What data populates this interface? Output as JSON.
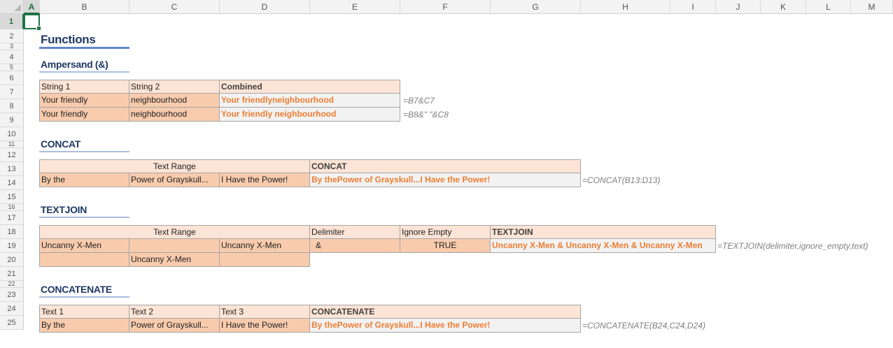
{
  "columns": [
    "A",
    "B",
    "C",
    "D",
    "E",
    "F",
    "G",
    "H",
    "I",
    "J",
    "K",
    "L",
    "M"
  ],
  "rows": [
    "1",
    "2",
    "3",
    "4",
    "5",
    "6",
    "7",
    "8",
    "9",
    "10",
    "11",
    "12",
    "13",
    "14",
    "15",
    "16",
    "17",
    "18",
    "19",
    "20",
    "21",
    "22",
    "23",
    "24",
    "25"
  ],
  "active_cell": "A1",
  "title": "Functions",
  "sections": {
    "ampersand": {
      "heading": "Ampersand (&)",
      "headers": [
        "String 1",
        "String 2",
        "Combined"
      ],
      "rows": [
        {
          "s1": "Your friendly",
          "s2": "neighbourhood",
          "combined": "Your friendlyneighbourhood",
          "formula": "=B7&C7"
        },
        {
          "s1": "Your friendly",
          "s2": "neighbourhood",
          "combined": "Your friendly neighbourhood",
          "formula": "=B8&\" \"&C8"
        }
      ]
    },
    "concat": {
      "heading": "CONCAT",
      "range_header": "Text Range",
      "result_header": "CONCAT",
      "values": [
        "By the",
        "Power of Grayskull...",
        "I Have the Power!"
      ],
      "result": "By thePower of Grayskull...I Have the Power!",
      "formula": "=CONCAT(B13:D13)"
    },
    "textjoin": {
      "heading": "TEXTJOIN",
      "range_header": "Text Range",
      "delimiter_header": "Delimiter",
      "ignore_header": "Ignore Empty",
      "result_header": "TEXTJOIN",
      "row18": [
        "Uncanny X-Men",
        "",
        "Uncanny X-Men"
      ],
      "row19": [
        "",
        "Uncanny X-Men",
        ""
      ],
      "delimiter": "&",
      "ignore_empty": "TRUE",
      "result": "Uncanny X-Men & Uncanny X-Men & Uncanny X-Men",
      "formula": "=TEXTJOIN(delimiter,ignore_empty,text)"
    },
    "concatenate": {
      "heading": "CONCATENATE",
      "headers": [
        "Text 1",
        "Text 2",
        "Text 3",
        "CONCATENATE"
      ],
      "values": [
        "By the",
        "Power of Grayskull...",
        "I Have the Power!"
      ],
      "result": "By thePower of Grayskull...I Have the Power!",
      "formula": "=CONCATENATE(B24,C24,D24)"
    }
  },
  "colors": {
    "header_fill": "#fce4d6",
    "data_fill": "#f8cbad",
    "result_fill": "#f2f2f2",
    "result_text": "#ed7d31",
    "heading_text": "#1f3864",
    "selection": "#217346"
  }
}
